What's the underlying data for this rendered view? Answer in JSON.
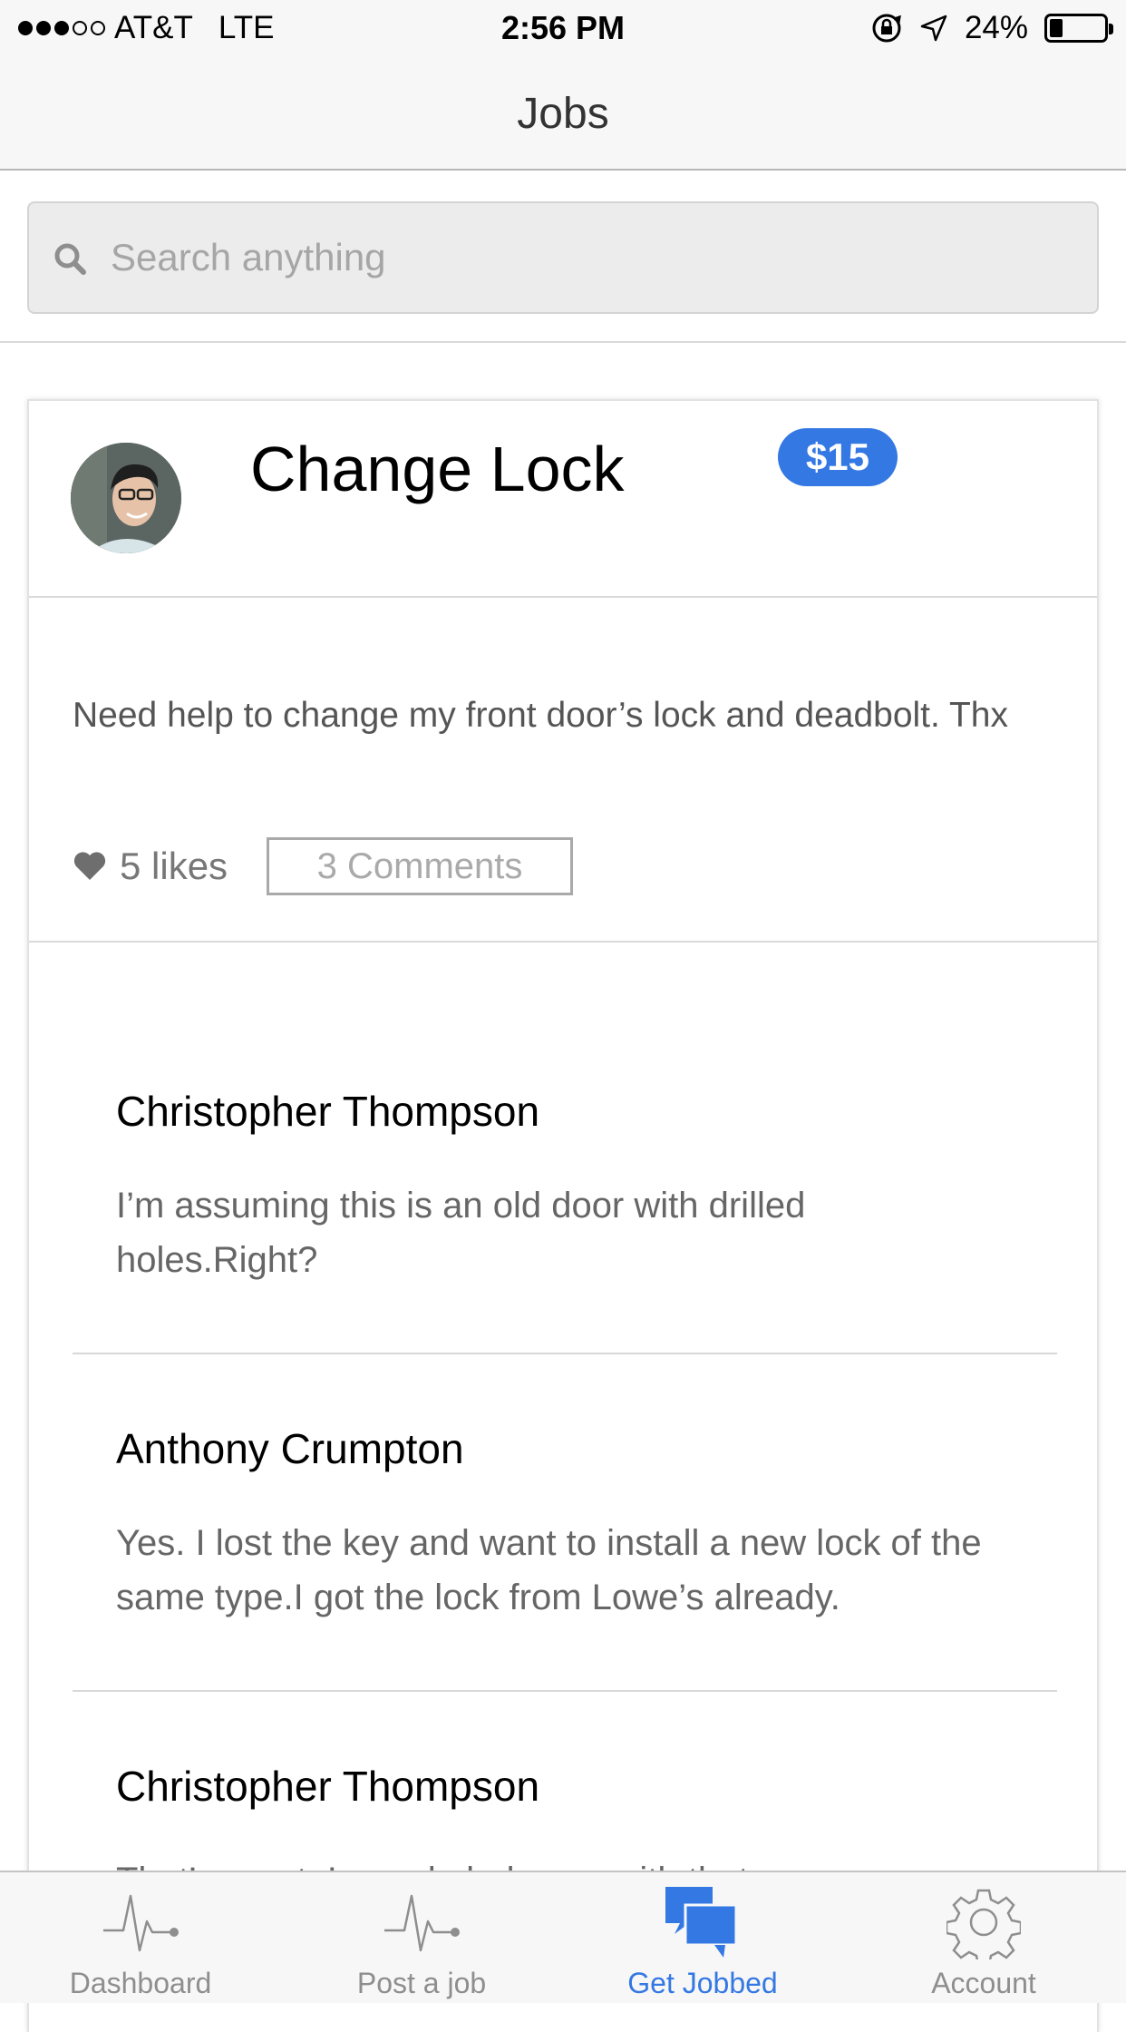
{
  "status_bar": {
    "carrier": "AT&T",
    "network": "LTE",
    "time": "2:56 PM",
    "battery": "24%",
    "battery_level": 0.24,
    "signal_bars": 3
  },
  "nav": {
    "title": "Jobs"
  },
  "search": {
    "placeholder": "Search anything"
  },
  "job": {
    "title": "Change Lock",
    "price": "$15",
    "description": "Need help to change my front door’s lock and deadbolt. Thx",
    "likes": "5 likes",
    "comments_label": "3 Comments"
  },
  "comments": [
    {
      "author": "Christopher Thompson",
      "text": "I’m assuming this is an old door with drilled holes.Right?"
    },
    {
      "author": "Anthony Crumpton",
      "text": "Yes. I lost the key and want to install a new lock of the same type.I got the lock from Lowe’s already."
    },
    {
      "author": "Christopher Thompson",
      "text": "That’s great. I can do help you with that."
    }
  ],
  "tabs": [
    {
      "label": "Dashboard",
      "icon": "pulse-icon",
      "active": false
    },
    {
      "label": "Post a job",
      "icon": "pulse-icon",
      "active": false
    },
    {
      "label": "Get Jobbed",
      "icon": "chat-bubbles-icon",
      "active": true
    },
    {
      "label": "Account",
      "icon": "gear-icon",
      "active": false
    }
  ],
  "colors": {
    "accent": "#3478e4",
    "inactive": "#8e8e8e"
  }
}
